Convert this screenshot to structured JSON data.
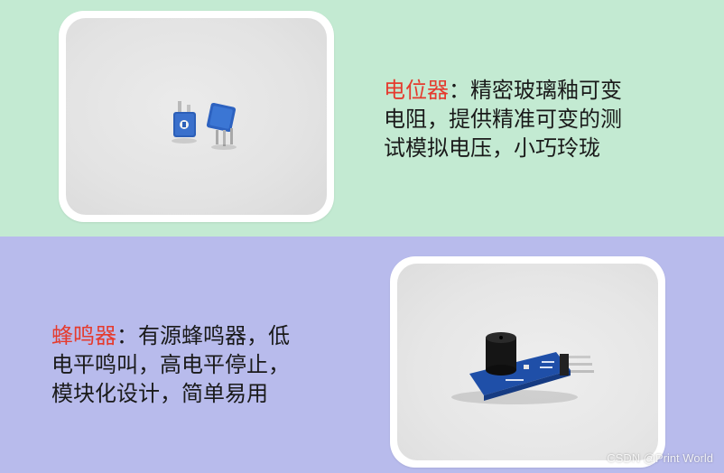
{
  "potentiometer": {
    "title": "电位器",
    "separator": "：",
    "line1": "精密玻璃釉可变",
    "line2": "电阻，提供精准可变的测",
    "line3": "试模拟电压，小巧玲珑",
    "image_icon": "potentiometer-photo"
  },
  "buzzer": {
    "title": "蜂鸣器",
    "separator": "：",
    "line1": "有源蜂鸣器，低",
    "line2": "电平鸣叫，高电平停止，",
    "line3": "模块化设计，简单易用",
    "image_icon": "buzzer-module-photo"
  },
  "watermark": "CSDN @Print World",
  "colors": {
    "top_background": "#c3ead2",
    "bottom_background": "#b8bbec",
    "title_accent": "#e53b2e"
  }
}
